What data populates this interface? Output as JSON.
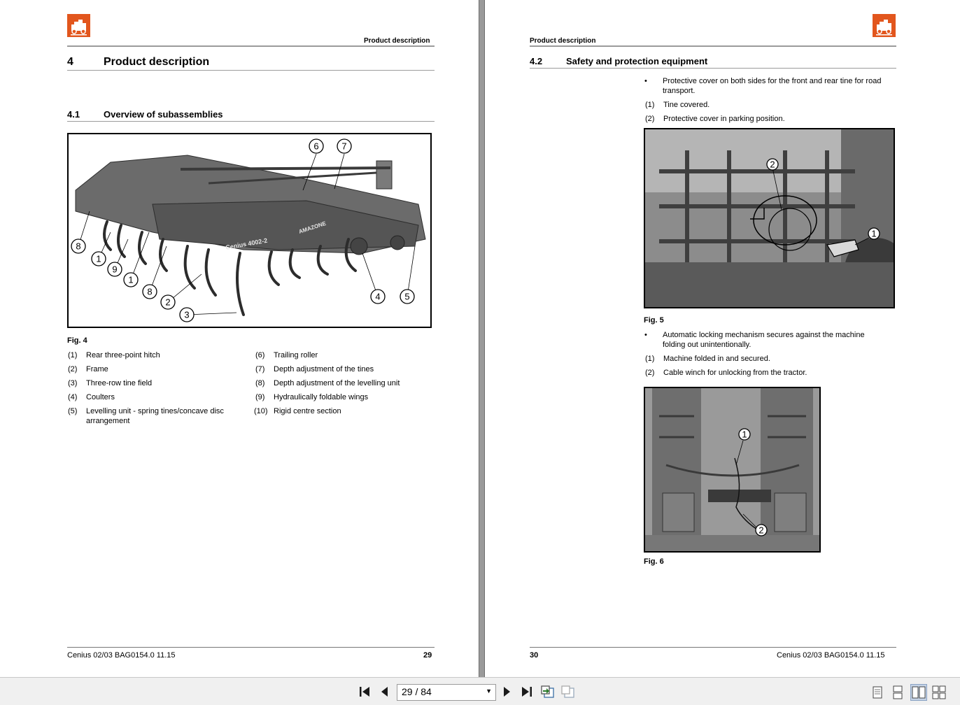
{
  "left_page": {
    "header": "Product description",
    "chapter": {
      "number": "4",
      "title": "Product description"
    },
    "section": {
      "number": "4.1",
      "title": "Overview of subassemblies"
    },
    "figure": {
      "caption": "Fig. 4",
      "machine_label": "Cenius 4002-2",
      "brand_label": "AMAZONE",
      "callouts": [
        "8",
        "1",
        "9",
        "1",
        "8",
        "2",
        "3",
        "6",
        "7",
        "4",
        "5"
      ]
    },
    "legend": [
      {
        "num": "(1)",
        "text": "Rear three-point hitch"
      },
      {
        "num": "(2)",
        "text": "Frame"
      },
      {
        "num": "(3)",
        "text": "Three-row tine field"
      },
      {
        "num": "(4)",
        "text": "Coulters"
      },
      {
        "num": "(5)",
        "text": "Levelling unit - spring tines/concave disc arrangement"
      },
      {
        "num": "(6)",
        "text": "Trailing roller"
      },
      {
        "num": "(7)",
        "text": "Depth adjustment of the tines"
      },
      {
        "num": "(8)",
        "text": "Depth adjustment of the levelling unit"
      },
      {
        "num": "(9)",
        "text": "Hydraulically foldable wings"
      },
      {
        "num": "(10)",
        "text": "Rigid centre section"
      }
    ],
    "footer": {
      "doc": "Cenius 02/03  BAG0154.0  11.15",
      "page": "29"
    }
  },
  "right_page": {
    "header": "Product description",
    "section": {
      "number": "4.2",
      "title": "Safety and protection equipment"
    },
    "block1": {
      "bullet": "•",
      "bullet_text": "Protective cover on both sides for the front and rear tine for road transport.",
      "items": [
        {
          "num": "(1)",
          "text": "Tine covered."
        },
        {
          "num": "(2)",
          "text": "Protective cover in parking position."
        }
      ]
    },
    "figure5": {
      "caption": "Fig. 5",
      "callouts": [
        "2",
        "1"
      ]
    },
    "block2": {
      "bullet": "•",
      "bullet_text": "Automatic locking mechanism secures against the machine folding out unintentionally.",
      "items": [
        {
          "num": "(1)",
          "text": "Machine folded in and secured."
        },
        {
          "num": "(2)",
          "text": "Cable winch for unlocking from the tractor."
        }
      ]
    },
    "figure6": {
      "caption": "Fig. 6",
      "callouts": [
        "1",
        "2"
      ]
    },
    "footer": {
      "page": "30",
      "doc": "Cenius 02/03  BAG0154.0  11.15"
    }
  },
  "toolbar": {
    "page_indicator": "29 / 84",
    "icons": [
      "first-page-icon",
      "prev-page-icon",
      "next-page-icon",
      "last-page-icon",
      "copy-icon",
      "copy-disabled-icon",
      "single-page-view-icon",
      "continuous-view-icon",
      "two-page-view-icon",
      "two-page-continuous-view-icon"
    ]
  },
  "colors": {
    "logo": "#e2561d",
    "rule": "#9b9b9b",
    "gutter": "#9a9a9a",
    "toolbar": "#f0f0f0",
    "active_view": "#c5d3e6"
  }
}
